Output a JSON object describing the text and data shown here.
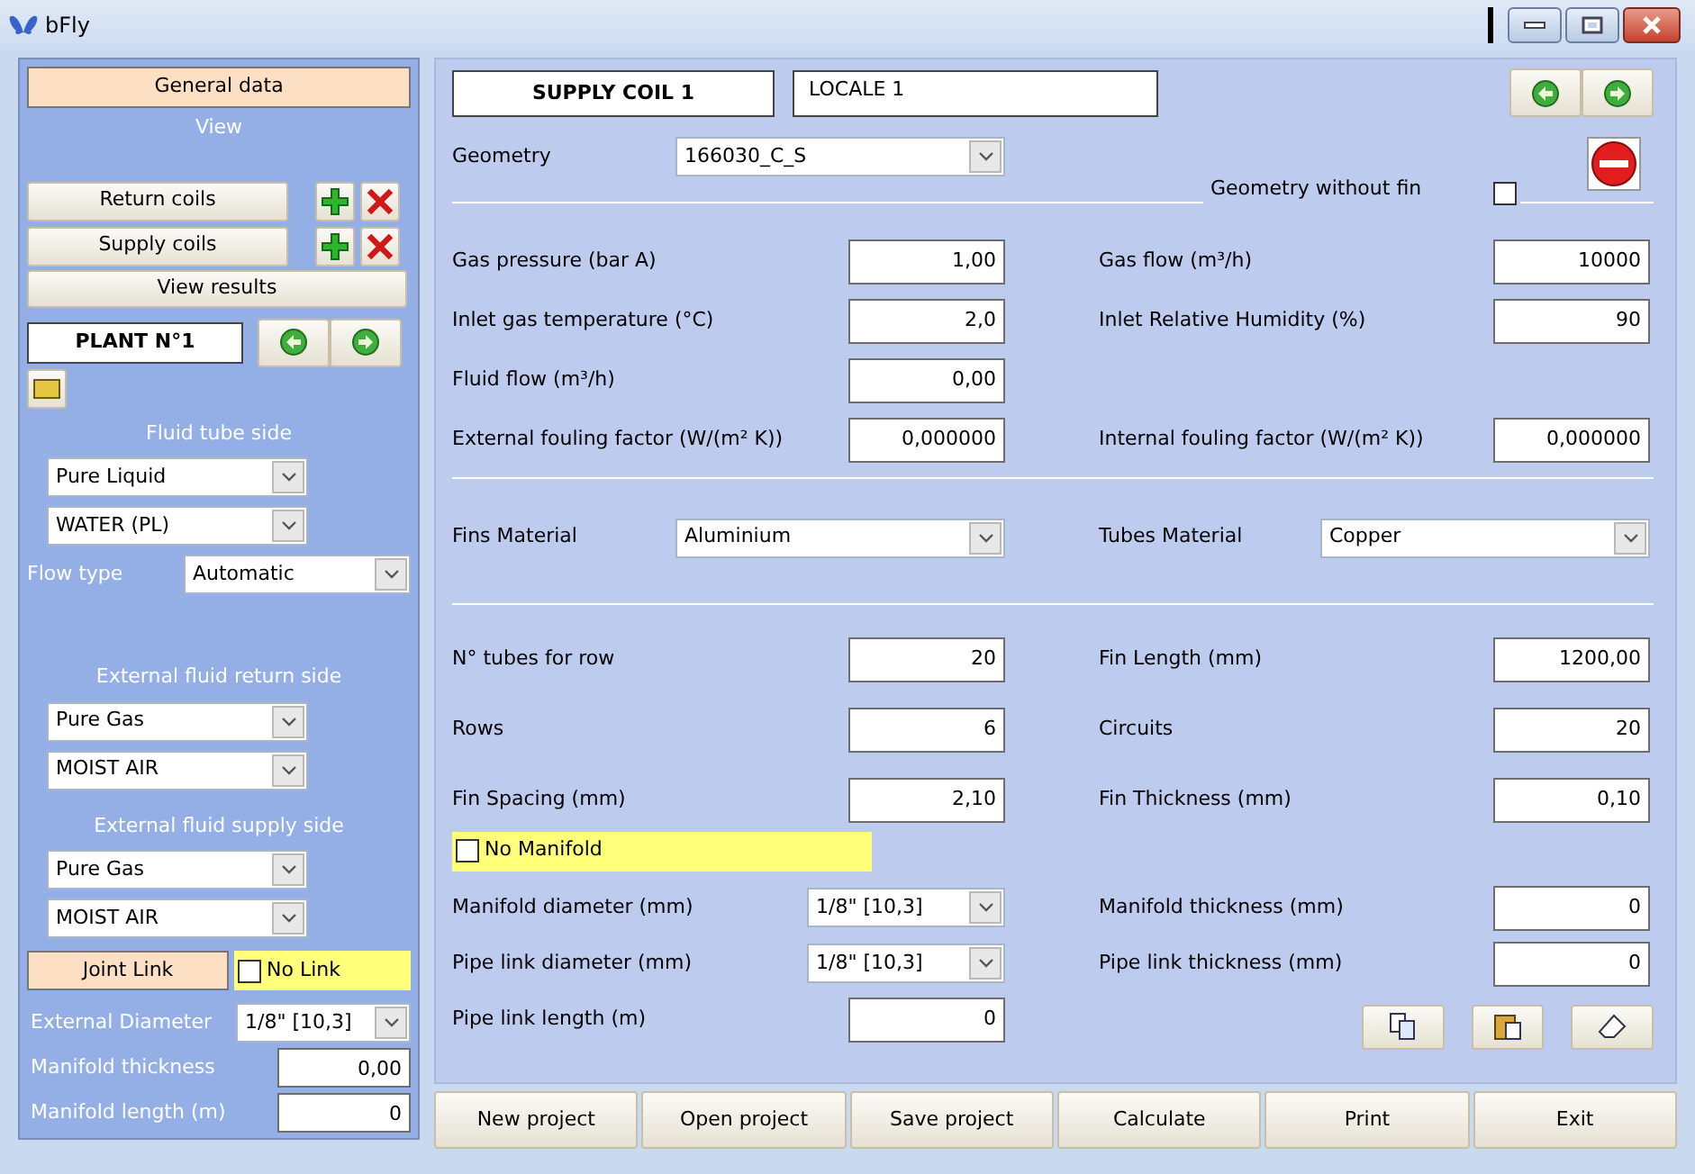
{
  "window": {
    "title": "bFly"
  },
  "left": {
    "general_data": "General data",
    "view_label": "View",
    "coil_buttons": [
      {
        "label": "Return coils"
      },
      {
        "label": "Supply coils"
      }
    ],
    "view_results": "View results",
    "plant_name": "PLANT N°1",
    "groups": [
      {
        "title": "Fluid tube side",
        "dropdowns": [
          "Pure Liquid",
          "WATER (PL)"
        ],
        "flow_type": {
          "label": "Flow type",
          "value": "Automatic"
        }
      },
      {
        "title": "External fluid return side",
        "dropdowns": [
          "Pure Gas",
          "MOIST AIR"
        ]
      },
      {
        "title": "External fluid supply side",
        "dropdowns": [
          "Pure Gas",
          "MOIST AIR"
        ]
      }
    ],
    "joint_link": "Joint Link",
    "no_link": {
      "label": "No Link",
      "checked": false
    },
    "fields": [
      {
        "label": "External Diameter",
        "value": "1/8\" [10,3]",
        "kind": "select"
      },
      {
        "label": "Manifold thickness",
        "value": "0,00",
        "kind": "input"
      },
      {
        "label": "Manifold length (m)",
        "value": "0",
        "kind": "input"
      }
    ]
  },
  "right": {
    "coil_name": "SUPPLY COIL 1",
    "locale": "LOCALE 1",
    "geometry": {
      "label": "Geometry",
      "value": "166030_C_S"
    },
    "geometry_without_fin": {
      "label": "Geometry without fin",
      "checked": false
    },
    "section_1": [
      {
        "left": {
          "label": "Gas pressure (bar A)",
          "value": "1,00",
          "kind": "input"
        },
        "right": {
          "label": "Gas flow (m³/h)",
          "value": "10000",
          "kind": "input"
        }
      },
      {
        "left": {
          "label": "Inlet gas temperature (°C)",
          "value": "2,0",
          "kind": "input"
        },
        "right": {
          "label": "Inlet Relative Humidity (%)",
          "value": "90",
          "kind": "input"
        }
      },
      {
        "left": {
          "label": "Fluid flow (m³/h)",
          "value": "0,00",
          "kind": "input"
        }
      },
      {
        "left": {
          "label": "External fouling factor (W/(m² K))",
          "value": "0,000000",
          "kind": "input"
        },
        "right": {
          "label": "Internal fouling factor (W/(m² K))",
          "value": "0,000000",
          "kind": "input"
        }
      }
    ],
    "section_2": [
      {
        "left": {
          "label": "Fins Material",
          "value": "Aluminium",
          "kind": "select"
        },
        "right": {
          "label": "Tubes Material",
          "value": "Copper",
          "kind": "select"
        }
      }
    ],
    "section_3": [
      {
        "left": {
          "label": "N° tubes for row",
          "value": "20",
          "kind": "input"
        },
        "right": {
          "label": "Fin Length (mm)",
          "value": "1200,00",
          "kind": "input"
        }
      },
      {
        "left": {
          "label": "Rows",
          "value": "6",
          "kind": "input"
        },
        "right": {
          "label": "Circuits",
          "value": "20",
          "kind": "input"
        }
      },
      {
        "left": {
          "label": "Fin Spacing (mm)",
          "value": "2,10",
          "kind": "input"
        },
        "right": {
          "label": "Fin Thickness (mm)",
          "value": "0,10",
          "kind": "input"
        }
      }
    ],
    "no_manifold": {
      "label": "No Manifold",
      "checked": false
    },
    "section_4": [
      {
        "left": {
          "label": "Manifold diameter (mm)",
          "value": "1/8\" [10,3]",
          "kind": "small_select"
        },
        "right": {
          "label": "Manifold thickness (mm)",
          "value": "0",
          "kind": "input"
        }
      },
      {
        "left": {
          "label": "Pipe link diameter (mm)",
          "value": "1/8\" [10,3]",
          "kind": "small_select"
        },
        "right": {
          "label": "Pipe link thickness (mm)",
          "value": "0",
          "kind": "input"
        }
      },
      {
        "left": {
          "label": "Pipe link length (m)",
          "value": "0",
          "kind": "input"
        }
      }
    ]
  },
  "bottom_buttons": [
    "New project",
    "Open project",
    "Save project",
    "Calculate",
    "Print",
    "Exit"
  ]
}
